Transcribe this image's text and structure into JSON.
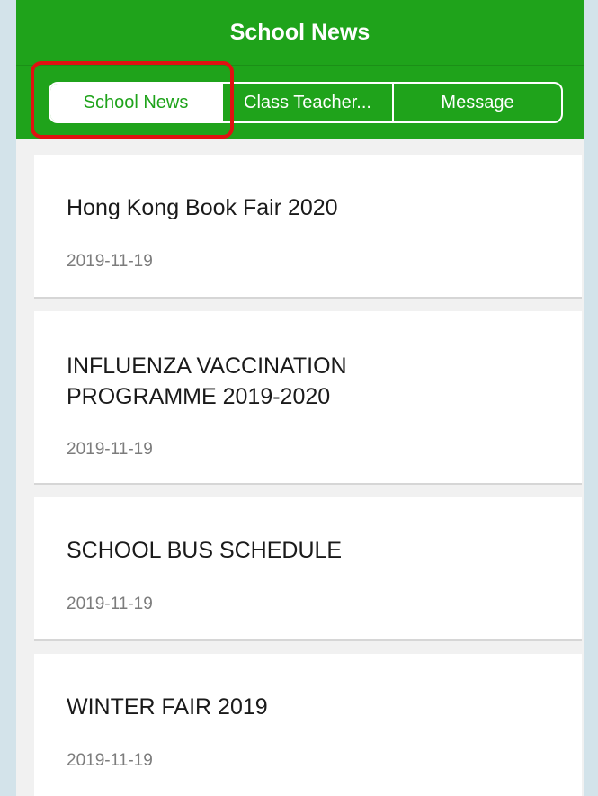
{
  "header": {
    "title": "School News"
  },
  "tabs": [
    {
      "label": "School News",
      "active": true
    },
    {
      "label": "Class Teacher...",
      "active": false
    },
    {
      "label": "Message",
      "active": false
    }
  ],
  "news": [
    {
      "title": "Hong Kong Book Fair 2020",
      "date": "2019-11-19"
    },
    {
      "title": "INFLUENZA VACCINATION PROGRAMME 2019-2020",
      "date": "2019-11-19"
    },
    {
      "title": "SCHOOL BUS SCHEDULE",
      "date": "2019-11-19"
    },
    {
      "title": "WINTER FAIR 2019",
      "date": "2019-11-19"
    }
  ],
  "colors": {
    "brand_green": "#1fa31b",
    "highlight_red": "#e01111",
    "page_background": "#f1f1f1",
    "frame_background": "#d3e3ea"
  }
}
